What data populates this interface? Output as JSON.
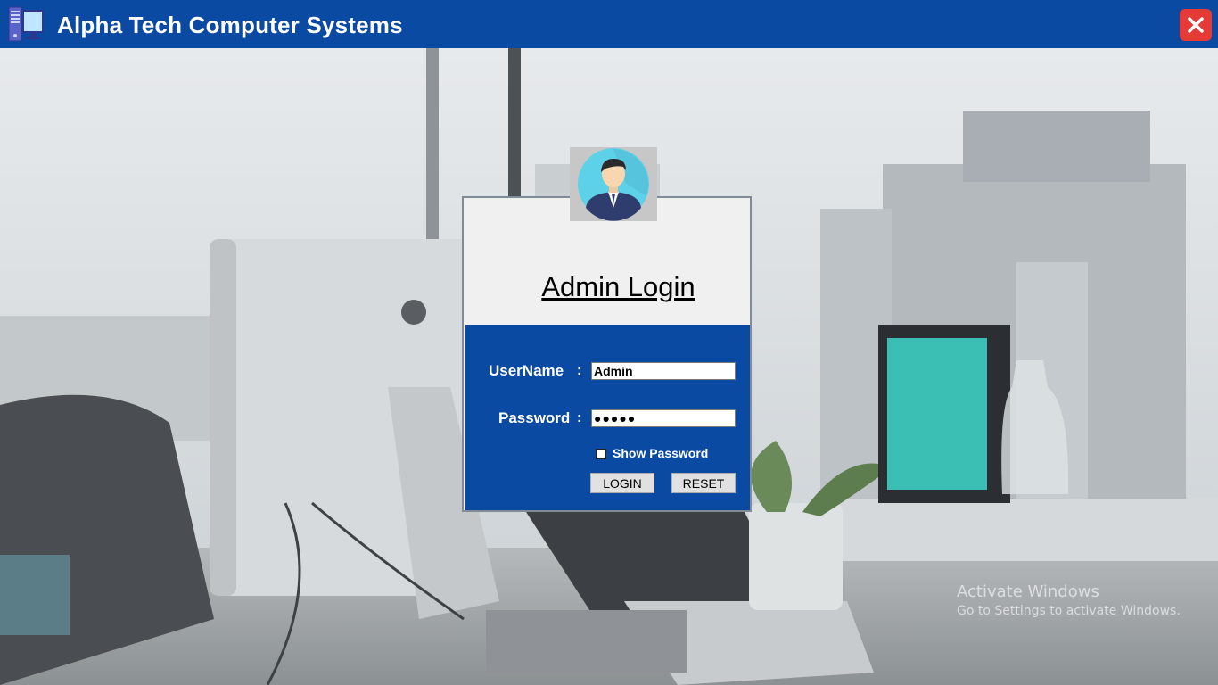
{
  "window": {
    "title": "Alpha Tech Computer Systems",
    "accent_color": "#0b4aa2",
    "close_color": "#e53a35",
    "icon": "computer-icon"
  },
  "login": {
    "title": "Admin Login",
    "avatar": "user-avatar-icon",
    "username_label": "UserName",
    "username_value": "Admin",
    "password_label": "Password",
    "password_value": "●●●●●",
    "separator": ":",
    "show_password_label": "Show Password",
    "show_password_checked": false,
    "login_button": "LOGIN",
    "reset_button": "RESET"
  },
  "watermark": {
    "line1": "Activate Windows",
    "line2": "Go to Settings to activate Windows."
  }
}
